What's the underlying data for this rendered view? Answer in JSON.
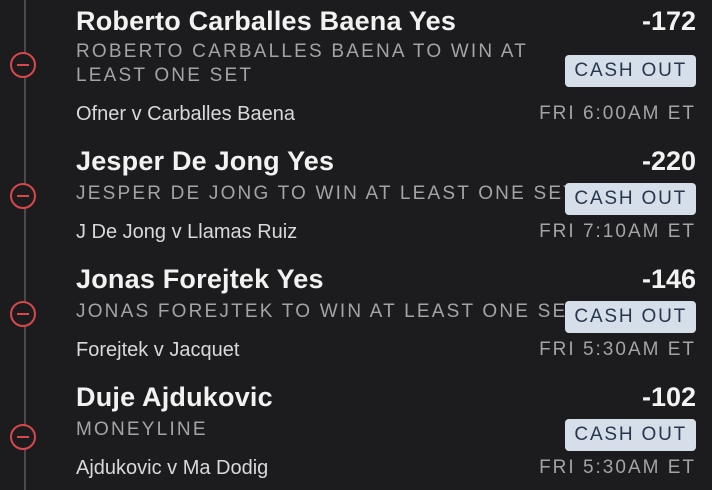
{
  "accent_color": "#d8484b",
  "cashout_bg": "#d6dfe9",
  "remove_icon": "minus-circle-icon",
  "legs": [
    {
      "title": "Roberto Carballes Baena Yes",
      "odds": "-172",
      "market": "ROBERTO CARBALLES BAENA TO WIN AT LEAST ONE SET",
      "cashout_label": "CASH OUT",
      "event": "Ofner v Carballes Baena",
      "time": "FRI 6:00AM ET"
    },
    {
      "title": "Jesper De Jong Yes",
      "odds": "-220",
      "market": "JESPER DE JONG TO WIN AT LEAST ONE SET",
      "cashout_label": "CASH OUT",
      "event": "J De Jong v Llamas Ruiz",
      "time": "FRI 7:10AM ET"
    },
    {
      "title": "Jonas Forejtek Yes",
      "odds": "-146",
      "market": "JONAS FOREJTEK TO WIN AT LEAST ONE SET",
      "cashout_label": "CASH OUT",
      "event": "Forejtek v Jacquet",
      "time": "FRI 5:30AM ET"
    },
    {
      "title": "Duje Ajdukovic",
      "odds": "-102",
      "market": "MONEYLINE",
      "cashout_label": "CASH OUT",
      "event": "Ajdukovic v Ma Dodig",
      "time": "FRI 5:30AM ET"
    }
  ]
}
